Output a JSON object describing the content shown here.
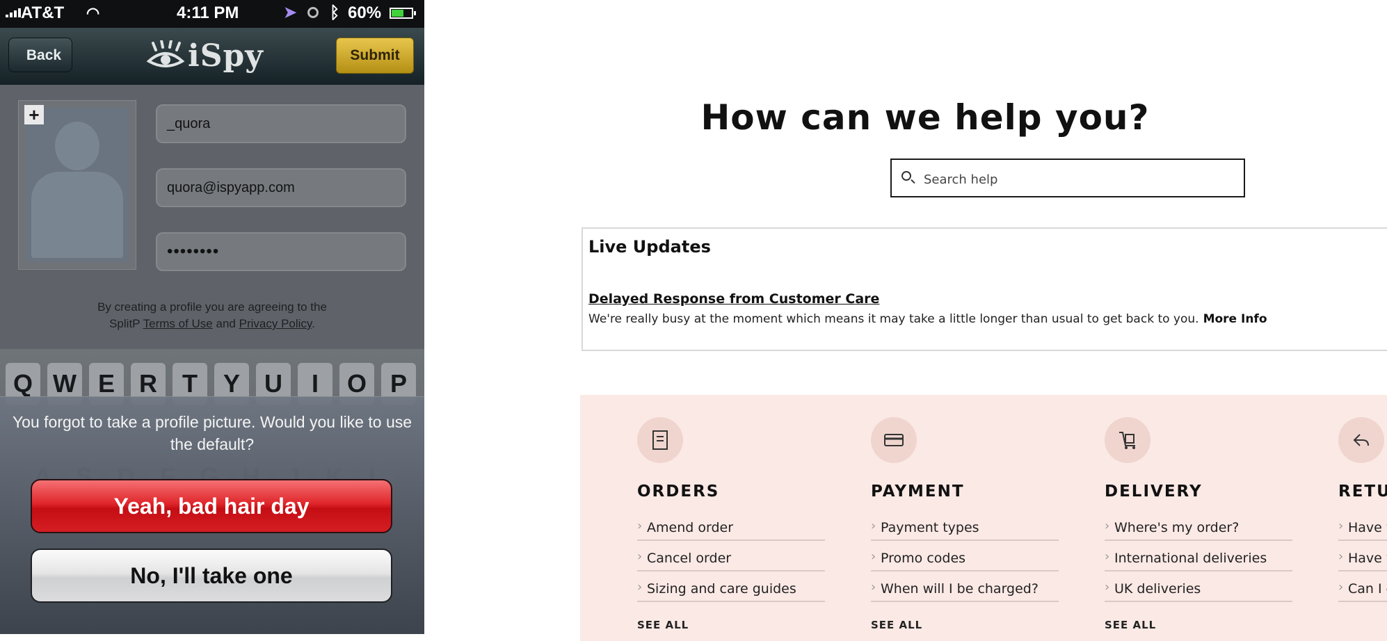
{
  "phone": {
    "status_bar": {
      "carrier": "AT&T",
      "time": "4:11 PM",
      "battery_percent": "60%",
      "battery_level": 0.6
    },
    "navbar": {
      "back_label": "Back",
      "logo_text": "iSpy",
      "submit_label": "Submit"
    },
    "form": {
      "username_value": "_quora",
      "email_value": "quora@ispyapp.com",
      "password_value": "••••••••",
      "add_photo_label": "+",
      "terms_text_1": "By creating a profile you are agreeing to the",
      "terms_text_2": "SplitP",
      "terms_link": "Terms of Use",
      "terms_and": "and",
      "privacy_link": "Privacy Policy",
      "terms_end": "."
    },
    "keyboard": {
      "row1": [
        "Q",
        "W",
        "E",
        "R",
        "T",
        "Y",
        "U",
        "I",
        "O",
        "P"
      ],
      "row2": [
        "A",
        "S",
        "D",
        "F",
        "G",
        "H",
        "J",
        "K",
        "L"
      ]
    },
    "alert": {
      "message": "You forgot to take a profile picture. Would you like to use the default?",
      "primary_label": "Yeah, bad hair day",
      "secondary_label": "No, I'll take one"
    }
  },
  "help": {
    "title": "How can we help you?",
    "search_placeholder": "Search help",
    "live_updates": {
      "title": "Live Updates",
      "link": "Delayed Response from Customer Care",
      "text": "We're really busy at the moment which means it may take a little longer than usual to get back to you.",
      "more": "More Info"
    },
    "topics": [
      {
        "heading": "ORDERS",
        "icon": "document-icon",
        "links": [
          "Amend order",
          "Cancel order",
          "Sizing and care guides"
        ],
        "see_all": "SEE ALL"
      },
      {
        "heading": "PAYMENT",
        "icon": "card-icon",
        "links": [
          "Payment types",
          "Promo codes",
          "When will I be charged?"
        ],
        "see_all": "SEE ALL"
      },
      {
        "heading": "DELIVERY",
        "icon": "trolley-icon",
        "links": [
          "Where's my order?",
          "International deliveries",
          "UK deliveries"
        ],
        "see_all": "SEE ALL"
      },
      {
        "heading": "RETURN",
        "icon": "return-arrow-icon",
        "links": [
          "Have you",
          "Have you Internatio",
          "Can I ex"
        ],
        "see_all": ""
      }
    ]
  },
  "colors": {
    "alert_primary": "#d41e23",
    "submit_button": "#d4b02e",
    "topics_background": "#fbe9e5"
  }
}
